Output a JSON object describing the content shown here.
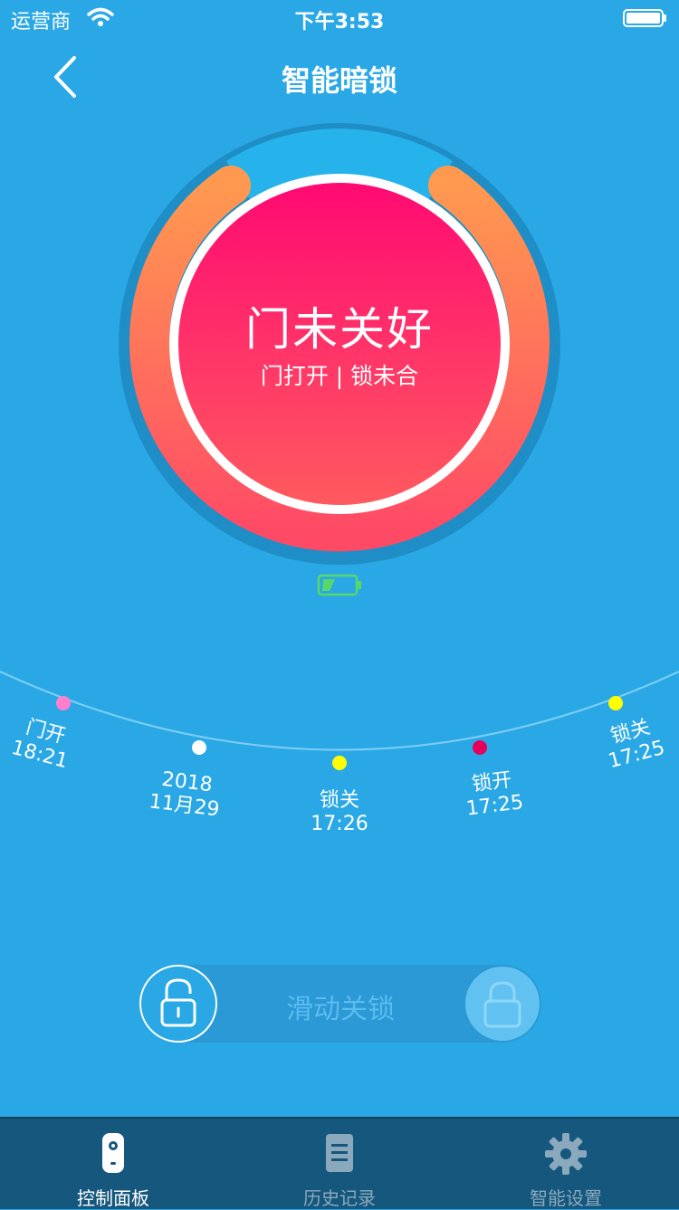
{
  "status_bar": {
    "carrier": "运营商",
    "time": "下午3:53"
  },
  "nav": {
    "title": "智能暗锁"
  },
  "lock_status": {
    "main": "门未关好",
    "detail": "门打开 | 锁未合"
  },
  "timeline": {
    "events": [
      {
        "line1": "门开",
        "line2": "18:21",
        "dot_color": "#ff7fcf"
      },
      {
        "line1": "2018",
        "line2": "11月29",
        "dot_color": "#ffffff"
      },
      {
        "line1": "锁关",
        "line2": "17:26",
        "dot_color": "#ffff00"
      },
      {
        "line1": "锁开",
        "line2": "17:25",
        "dot_color": "#e6005c"
      },
      {
        "line1": "锁关",
        "line2": "17:25",
        "dot_color": "#ffff00"
      }
    ]
  },
  "slider": {
    "label": "滑动关锁"
  },
  "tabs": [
    {
      "label": "控制面板",
      "icon": "remote-icon",
      "active": true
    },
    {
      "label": "历史记录",
      "icon": "document-icon",
      "active": false
    },
    {
      "label": "智能设置",
      "icon": "gear-icon",
      "active": false
    }
  ],
  "colors": {
    "background": "#2aa8e6",
    "status_gradient_top": "#ff0a72",
    "status_gradient_bottom": "#ff5a5f",
    "ring_gradient_top": "#ff9950",
    "ring_gradient_bottom": "#ff4a66",
    "tab_bar": "#16577d",
    "tab_active": "#ffffff",
    "tab_inactive": "#8aa9bd"
  }
}
